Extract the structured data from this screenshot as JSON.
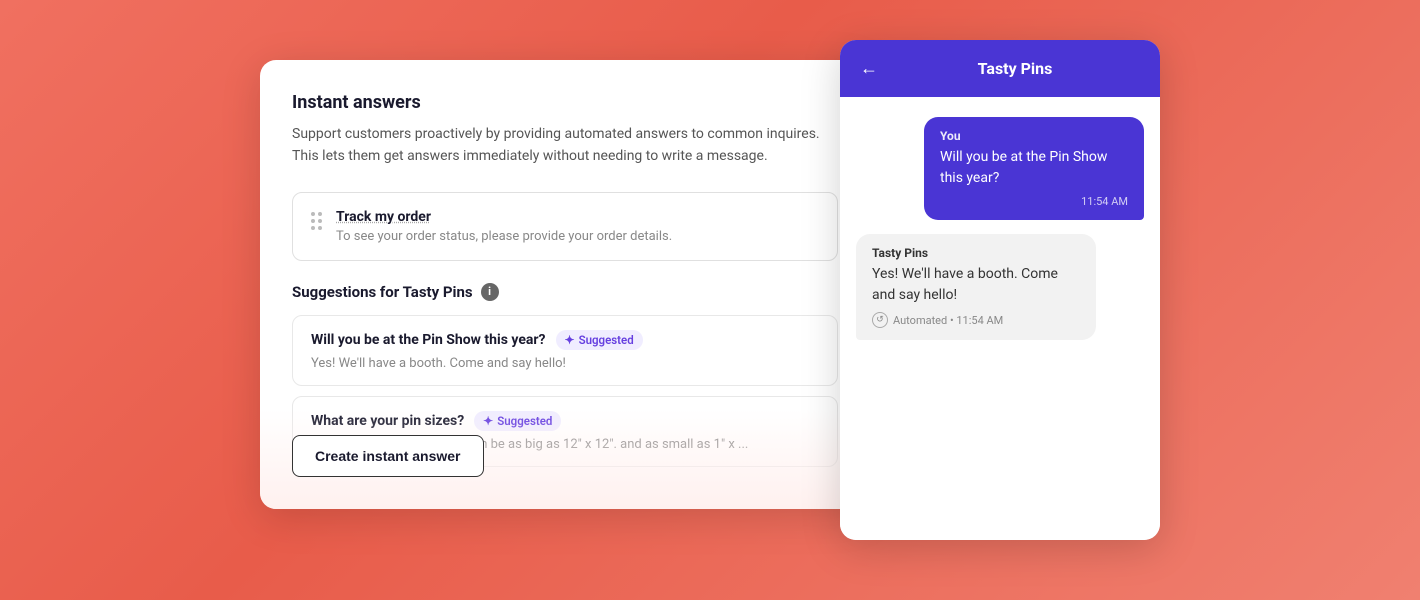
{
  "background": {
    "gradient_start": "#f07060",
    "gradient_end": "#e85c4a"
  },
  "main_panel": {
    "title": "Instant answers",
    "description": "Support customers proactively by providing automated answers to common inquires. This lets them get answers immediately without needing to write a message.",
    "order_card": {
      "title": "Track my order",
      "subtitle": "To see your order status, please provide your order details."
    },
    "suggestions_header": "Suggestions for Tasty Pins",
    "info_icon_label": "i",
    "suggestions": [
      {
        "title": "Will you be at the Pin Show this year?",
        "badge": "Suggested",
        "body": "Yes! We'll have a booth. Come and say hello!"
      },
      {
        "title": "What are your pin sizes?",
        "badge": "Suggested",
        "body": "Most pins are 3\" x 4\". They can be as big as 12\" x 12\". and as small as 1\" x ..."
      }
    ],
    "create_button_label": "Create instant answer"
  },
  "chat_panel": {
    "header_title": "Tasty Pins",
    "back_label": "←",
    "messages": [
      {
        "type": "user",
        "sender": "You",
        "text": "Will you be at the Pin Show this year?",
        "time": "11:54 AM"
      },
      {
        "type": "bot",
        "sender": "Tasty Pins",
        "text": "Yes! We'll have a booth. Come and say hello!",
        "meta": "Automated • 11:54 AM"
      }
    ]
  }
}
